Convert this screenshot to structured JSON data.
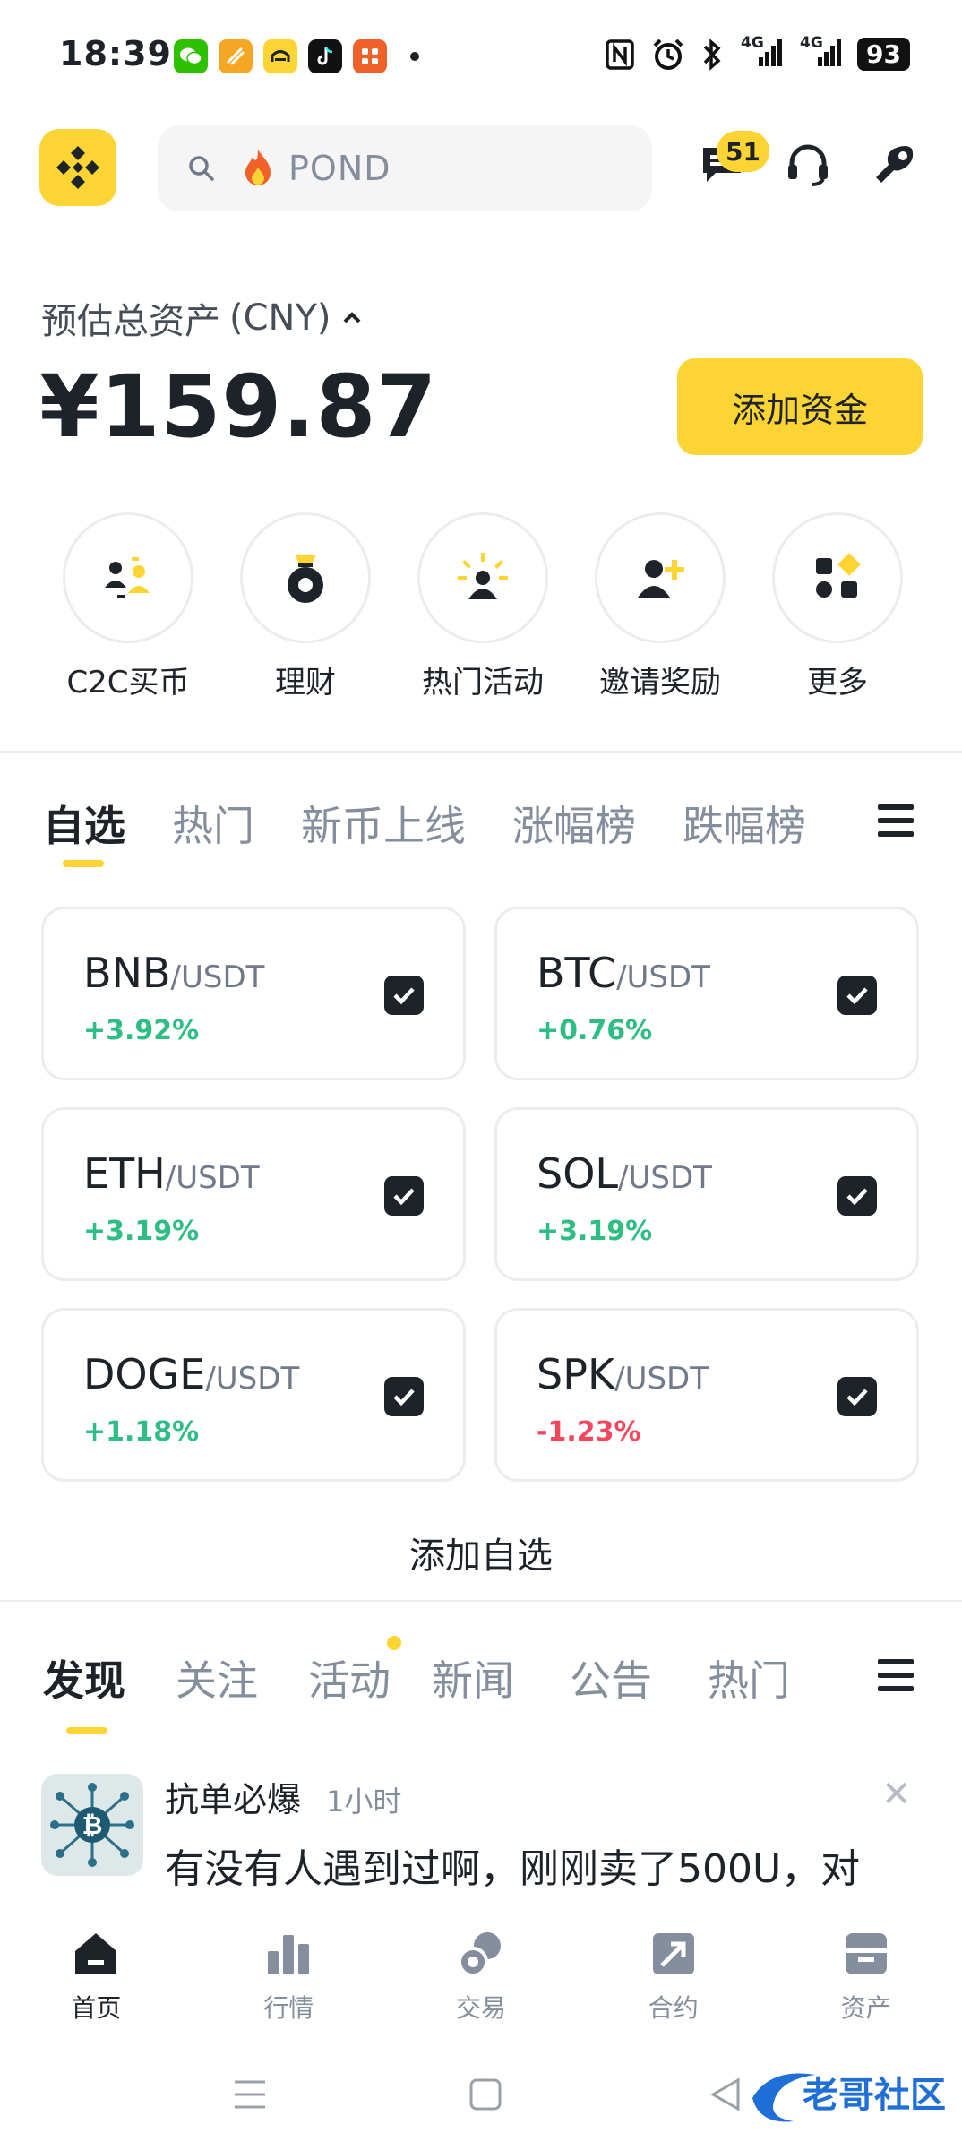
{
  "status_bar": {
    "time": "18:39",
    "network_1": "4G",
    "network_2": "4G",
    "battery": "93",
    "app_icons": [
      "wechat-icon",
      "app-orange-icon",
      "app-yellow-icon",
      "tiktok-icon",
      "app-red-icon"
    ]
  },
  "header": {
    "search_placeholder": "POND",
    "messages_badge": "51"
  },
  "balance": {
    "label": "预估总资产",
    "currency": "(CNY)",
    "value": "¥159.87",
    "add_funds_label": "添加资金"
  },
  "shortcuts": [
    {
      "label": "C2C买币",
      "icon": "c2c-icon"
    },
    {
      "label": "理财",
      "icon": "earn-icon"
    },
    {
      "label": "热门活动",
      "icon": "events-icon"
    },
    {
      "label": "邀请奖励",
      "icon": "invite-icon"
    },
    {
      "label": "更多",
      "icon": "more-icon"
    }
  ],
  "market_tabs": [
    "自选",
    "热门",
    "新币上线",
    "涨幅榜",
    "跌幅榜"
  ],
  "watchlist": [
    {
      "base": "BNB",
      "quote": "/USDT",
      "change": "+3.92%",
      "direction": "up"
    },
    {
      "base": "BTC",
      "quote": "/USDT",
      "change": "+0.76%",
      "direction": "up"
    },
    {
      "base": "ETH",
      "quote": "/USDT",
      "change": "+3.19%",
      "direction": "up"
    },
    {
      "base": "SOL",
      "quote": "/USDT",
      "change": "+3.19%",
      "direction": "up"
    },
    {
      "base": "DOGE",
      "quote": "/USDT",
      "change": "+1.18%",
      "direction": "up"
    },
    {
      "base": "SPK",
      "quote": "/USDT",
      "change": "-1.23%",
      "direction": "down"
    }
  ],
  "add_watchlist_label": "添加自选",
  "feed_tabs": [
    "发现",
    "关注",
    "活动",
    "新闻",
    "公告",
    "热门"
  ],
  "post": {
    "author": "抗单必爆",
    "time": "1小时",
    "text": "有没有人遇到过啊，刚刚卖了500U，对"
  },
  "bottom_nav": [
    {
      "label": "首页",
      "icon": "home-icon"
    },
    {
      "label": "行情",
      "icon": "markets-icon"
    },
    {
      "label": "交易",
      "icon": "trade-icon"
    },
    {
      "label": "合约",
      "icon": "futures-icon"
    },
    {
      "label": "资产",
      "icon": "wallet-icon"
    }
  ],
  "watermark_text": "老哥社区",
  "colors": {
    "brand_yellow": "#fcd535",
    "up_green": "#2ebd85",
    "down_red": "#f6465d",
    "text_primary": "#1e2329",
    "text_secondary": "#848e9c"
  }
}
